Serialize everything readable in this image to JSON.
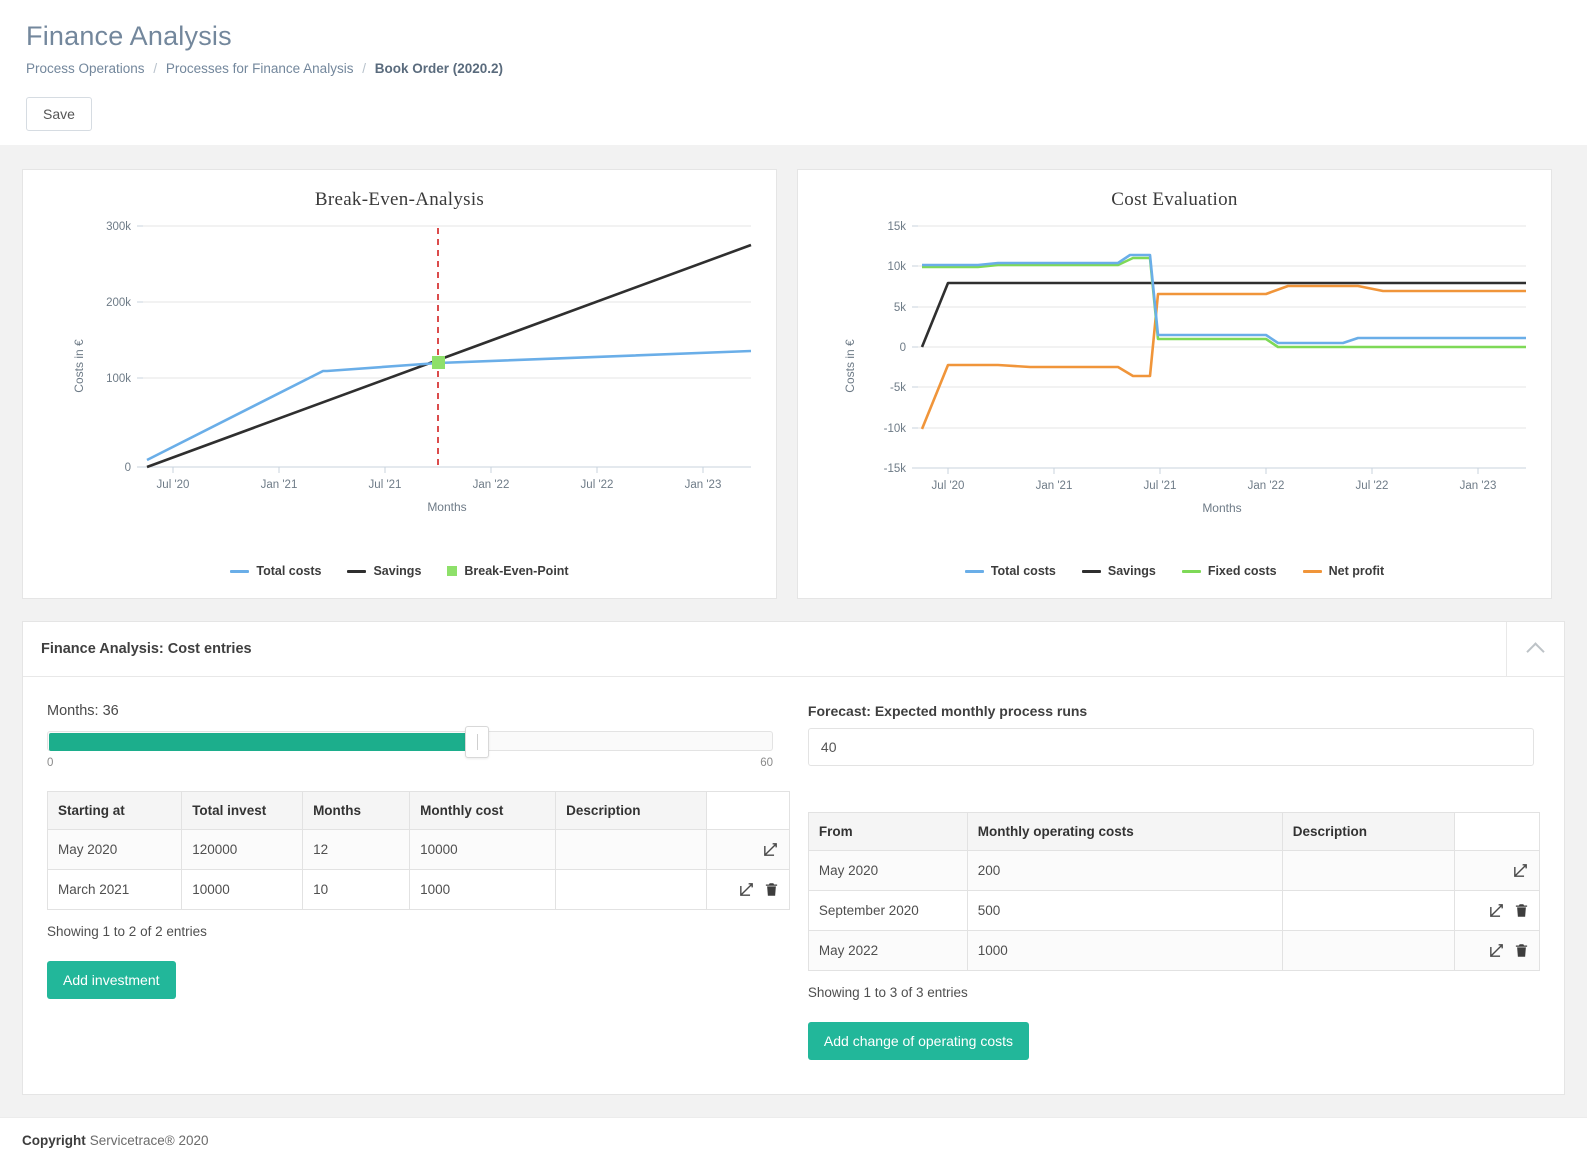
{
  "header": {
    "title": "Finance Analysis",
    "breadcrumb": [
      {
        "label": "Process Operations",
        "current": false
      },
      {
        "label": "Processes for Finance Analysis",
        "current": false
      },
      {
        "label": "Book Order (2020.2)",
        "current": true
      }
    ],
    "save_label": "Save"
  },
  "chart_data": [
    {
      "type": "line",
      "title": "Break-Even-Analysis",
      "xlabel": "Months",
      "ylabel": "Costs in €",
      "xticks": [
        "Jul '20",
        "Jan '21",
        "Jul '21",
        "Jan '22",
        "Jul '22",
        "Jan '23"
      ],
      "yticks": [
        "0",
        "100k",
        "200k",
        "300k"
      ],
      "ylim": [
        0,
        300000
      ],
      "xlim": [
        0,
        36
      ],
      "grid": true,
      "legend_position": "bottom",
      "annotations": [
        {
          "kind": "vertical-line",
          "label": "Break-Even",
          "x": 20,
          "color": "#cc0000",
          "style": "dashed"
        }
      ],
      "series": [
        {
          "name": "Total costs",
          "color": "#6aaee8",
          "x": [
            0,
            2,
            4,
            6,
            8,
            10,
            12,
            14,
            16,
            18,
            20,
            22,
            24,
            26,
            28,
            30,
            32,
            34,
            36
          ],
          "values": [
            8500,
            29000,
            48000,
            68000,
            87000,
            107000,
            126000,
            128000,
            130000,
            132000,
            135000,
            137000,
            139000,
            141000,
            143000,
            145000,
            148000,
            150000,
            152000
          ]
        },
        {
          "name": "Savings",
          "color": "#2f2f2f",
          "x": [
            0,
            36
          ],
          "values": [
            0,
            278000
          ]
        },
        {
          "name": "Break-Even-Point",
          "color": "#8ee06a",
          "marker": "square",
          "x": [
            20
          ],
          "values": [
            135000
          ]
        }
      ]
    },
    {
      "type": "line",
      "title": "Cost Evaluation",
      "xlabel": "Months",
      "ylabel": "Costs in €",
      "xticks": [
        "Jul '20",
        "Jan '21",
        "Jul '21",
        "Jan '22",
        "Jul '22",
        "Jan '23"
      ],
      "yticks": [
        "-15k",
        "-10k",
        "-5k",
        "0",
        "5k",
        "10k",
        "15k"
      ],
      "ylim": [
        -15000,
        15000
      ],
      "xlim": [
        0,
        36
      ],
      "grid": true,
      "legend_position": "bottom",
      "series": [
        {
          "name": "Total costs",
          "color": "#6aaee8",
          "x": [
            0,
            2,
            4,
            6,
            8,
            10,
            11,
            12,
            13,
            14,
            16,
            20,
            21,
            22,
            26,
            27,
            30,
            36
          ],
          "values": [
            10200,
            10200,
            10400,
            10500,
            10500,
            10500,
            11500,
            11500,
            1600,
            1600,
            1600,
            1600,
            600,
            600,
            600,
            1100,
            1100,
            1100
          ]
        },
        {
          "name": "Savings",
          "color": "#2f2f2f",
          "x": [
            0,
            2,
            36
          ],
          "values": [
            0,
            8000,
            8000
          ]
        },
        {
          "name": "Fixed costs",
          "color": "#7ed957",
          "x": [
            0,
            2,
            4,
            6,
            8,
            10,
            11,
            12,
            13,
            14,
            20,
            21,
            22,
            30,
            36
          ],
          "values": [
            10000,
            10000,
            10200,
            10300,
            10300,
            10300,
            11100,
            11100,
            1000,
            1000,
            1000,
            100,
            100,
            100,
            100
          ]
        },
        {
          "name": "Net profit",
          "color": "#f0953a",
          "x": [
            0,
            2,
            4,
            6,
            10,
            11,
            12,
            13,
            14,
            20,
            21,
            24,
            26,
            27,
            36
          ],
          "values": [
            -10200,
            -2200,
            -2200,
            -2500,
            -2500,
            -3500,
            -3500,
            6500,
            6500,
            6500,
            7600,
            7600,
            7600,
            7000,
            7000
          ]
        }
      ]
    }
  ],
  "panel": {
    "title": "Finance Analysis: Cost entries",
    "collapse_icon": "chevron-up-icon",
    "slider": {
      "label": "Months: 36",
      "value": 36,
      "min_label": "0",
      "max_label": "60",
      "min": 0,
      "max": 60
    },
    "investment_table": {
      "columns": [
        "Starting at",
        "Total invest",
        "Months",
        "Monthly cost",
        "Description",
        ""
      ],
      "rows": [
        {
          "cells": [
            "May 2020",
            "120000",
            "12",
            "10000",
            ""
          ],
          "actions": [
            "edit-icon"
          ]
        },
        {
          "cells": [
            "March 2021",
            "10000",
            "10",
            "1000",
            ""
          ],
          "actions": [
            "edit-icon",
            "delete-icon"
          ]
        }
      ],
      "entries_info": "Showing 1 to 2 of 2 entries",
      "add_button": "Add investment"
    },
    "forecast": {
      "label": "Forecast: Expected monthly process runs",
      "value": "40",
      "placeholder": "40"
    },
    "operating_table": {
      "columns": [
        "From",
        "Monthly operating costs",
        "Description",
        ""
      ],
      "rows": [
        {
          "cells": [
            "May 2020",
            "200",
            ""
          ],
          "actions": [
            "edit-icon"
          ]
        },
        {
          "cells": [
            "September 2020",
            "500",
            ""
          ],
          "actions": [
            "edit-icon",
            "delete-icon"
          ]
        },
        {
          "cells": [
            "May 2022",
            "1000",
            ""
          ],
          "actions": [
            "edit-icon",
            "delete-icon"
          ]
        }
      ],
      "entries_info": "Showing 1 to 3 of 3 entries",
      "add_button": "Add change of operating costs"
    }
  },
  "footer": {
    "bold": "Copyright",
    "text": " Servicetrace® 2020"
  },
  "colors": {
    "accent": "#22b79a",
    "slider_fill": "#1cae8c",
    "total_costs": "#6aaee8",
    "savings": "#2f2f2f",
    "fixed_costs": "#7ed957",
    "net_profit": "#f0953a",
    "break_even": "#8ee06a",
    "break_even_line": "#cc0000"
  }
}
